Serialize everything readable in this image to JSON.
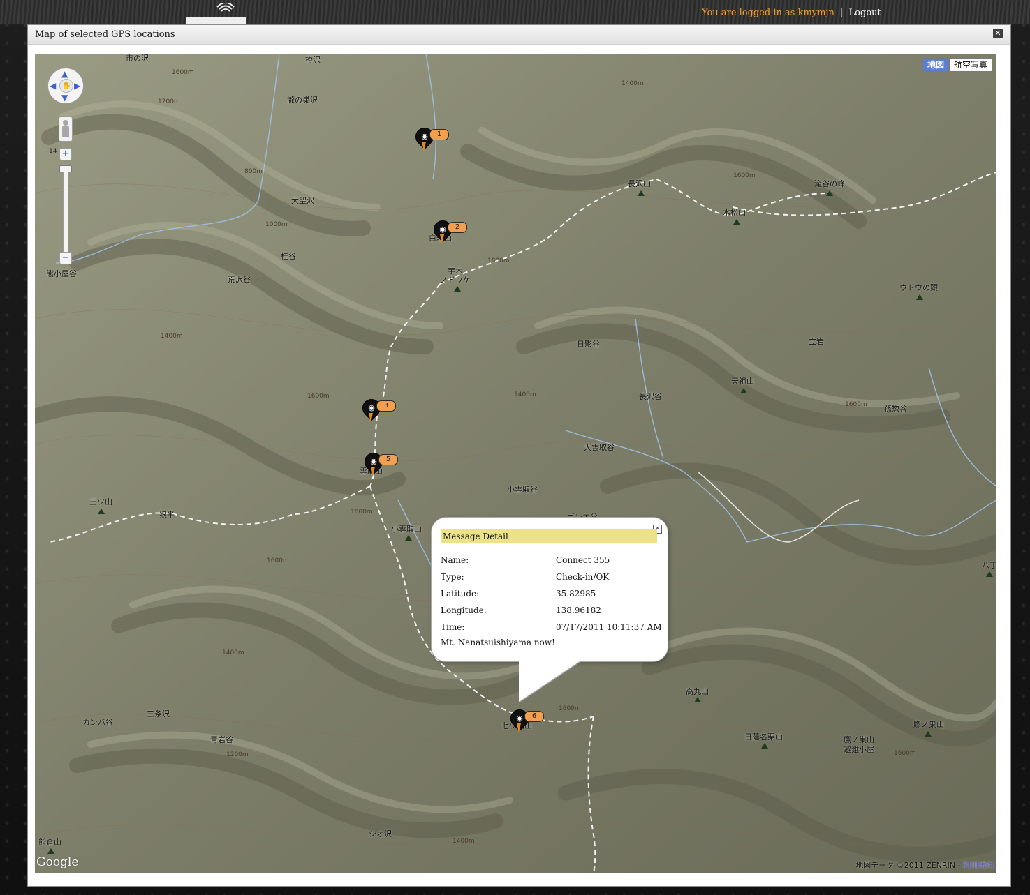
{
  "header": {
    "login_text": "You are logged in as kmymjn",
    "separator": "|",
    "logout": "Logout"
  },
  "dialog": {
    "title": "Map of selected GPS locations",
    "close_glyph": "✕"
  },
  "map": {
    "maptype_options": [
      "地図",
      "航空写真"
    ],
    "maptype_selected": "地図",
    "google_logo": "Google",
    "copyright": "地図データ ©2011 ZENRIN -",
    "terms": "利用規約",
    "controls": {
      "pan_up": "▲",
      "pan_down": "▼",
      "pan_left": "◀",
      "pan_right": "▶",
      "pan_center": "✋",
      "zoom_in": "+",
      "zoom_out": "−",
      "zoom_label": "14"
    },
    "markers": [
      {
        "number": "1",
        "icon": "gps-signal-icon"
      },
      {
        "number": "2",
        "icon": "gps-signal-icon"
      },
      {
        "number": "3",
        "icon": "gps-signal-icon"
      },
      {
        "number": "5",
        "icon": "gps-signal-icon"
      },
      {
        "number": "6",
        "icon": "gps-signal-icon"
      }
    ],
    "place_labels": [
      "市の沢",
      "樽沢",
      "瀧の巣沢",
      "大聖沢",
      "桂谷",
      "荒沢谷",
      "熊小屋谷",
      "白岩山",
      "芋木",
      "ノドッケ",
      "長沢山",
      "滝谷の峰",
      "水松山",
      "ウトウの頭",
      "日影谷",
      "立岩",
      "天祖山",
      "長沢谷",
      "孫惣谷",
      "大雲取谷",
      "小雲取谷",
      "雲取山",
      "三ツ山",
      "狼平",
      "小雲取山",
      "ゴンエ谷",
      "八丁",
      "高丸山",
      "七ツ石山",
      "日蔭名栗山",
      "鷹ノ巣山",
      "鷹ノ巣山",
      "避難小屋",
      "カンバ谷",
      "三条沢",
      "青岩谷",
      "シオ沢",
      "熊倉山"
    ],
    "contour_labels": [
      "1600m",
      "1200m",
      "1400m",
      "1800m",
      "1000m",
      "800m"
    ]
  },
  "info_window": {
    "title": "Message Detail",
    "close_glyph": "✕",
    "fields": [
      {
        "label": "Name:",
        "value": "Connect 355"
      },
      {
        "label": "Type:",
        "value": "Check-in/OK"
      },
      {
        "label": "Latitude:",
        "value": "35.82985"
      },
      {
        "label": "Longitude:",
        "value": "138.96182"
      },
      {
        "label": "Time:",
        "value": "07/17/2011 10:11:37 AM"
      }
    ],
    "message": "Mt. Nanatsuishiyama now!"
  }
}
